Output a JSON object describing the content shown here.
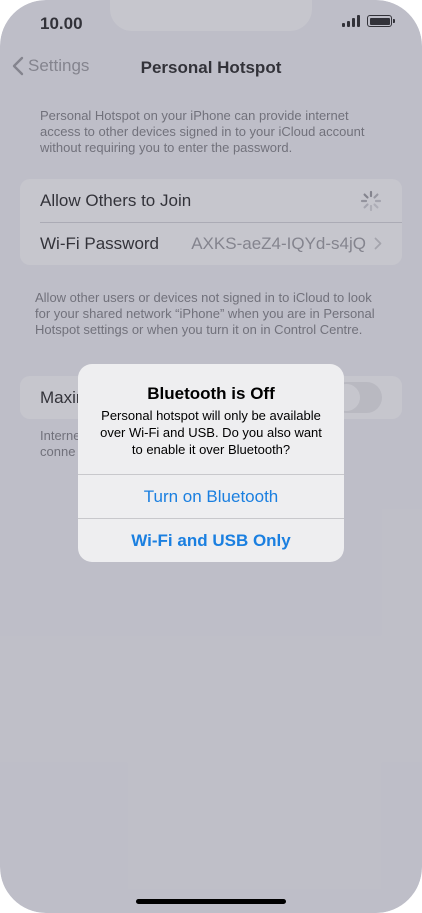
{
  "status_bar": {
    "time": "10.00"
  },
  "nav": {
    "back_label": "Settings",
    "title": "Personal Hotspot"
  },
  "intro_text": [
    "Personal Hotspot on your iPhone can provide internet",
    "access to other devices signed in to your iCloud account",
    "without requiring you to enter the password."
  ],
  "settings": {
    "allow_others_label": "Allow Others to Join",
    "wifi_password_label": "Wi-Fi Password",
    "wifi_password_value": "AXKS-aeZ4-IQYd-s4jQ"
  },
  "allow_info_text": [
    "Allow other users or devices not signed in to iCloud to look",
    "for your shared network “iPhone” when you are in Personal",
    "Hotspot settings or when you turn it on in Control Centre."
  ],
  "partial": {
    "maximise_label": "Maxir",
    "footer_line1": "Interne",
    "footer_line2": "conne"
  },
  "alert": {
    "title": "Bluetooth is Off",
    "message": [
      "Personal hotspot will only be available",
      "over Wi-Fi and USB. Do you also want",
      "to enable it over Bluetooth?"
    ],
    "button_bluetooth": "Turn on Bluetooth",
    "button_wifi_usb": "Wi-Fi and USB Only"
  },
  "colors": {
    "accent": "#1a7fe0",
    "background": "#f2f2f7"
  }
}
